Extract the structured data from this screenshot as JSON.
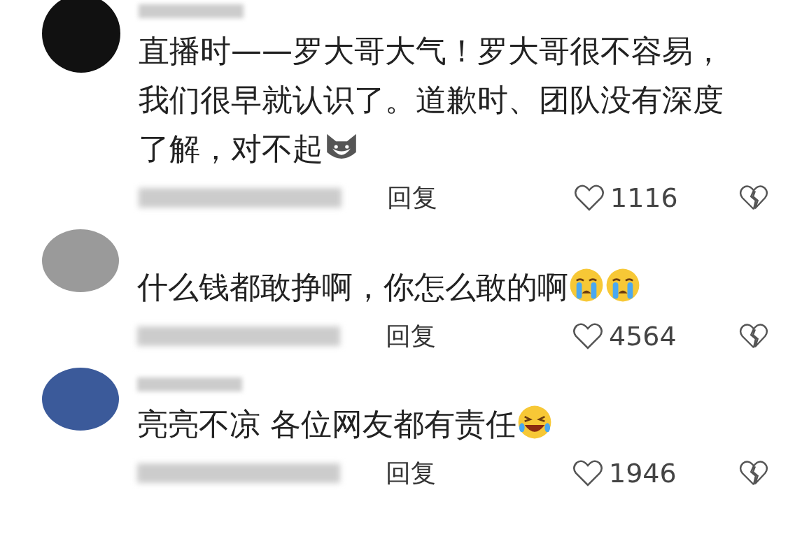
{
  "comments": [
    {
      "text": "直播时——罗大哥大气！罗大哥很不容易，我们很早就认识了。道歉时、团队没有深度了解，对不起",
      "emojis": [
        {
          "kind": "dog"
        }
      ],
      "reply": "回复",
      "likes": "1116",
      "avatar": {
        "kind": "hand"
      }
    },
    {
      "text": "什么钱都敢挣啊，你怎么敢的啊",
      "emojis": [
        {
          "kind": "cry"
        },
        {
          "kind": "cry"
        }
      ],
      "reply": "回复",
      "likes": "4564",
      "avatar": {
        "kind": "photo"
      }
    },
    {
      "text": "亮亮不凉 各位网友都有责任",
      "emojis": [
        {
          "kind": "laugh"
        }
      ],
      "reply": "回复",
      "likes": "1946",
      "avatar": {
        "kind": "painting"
      }
    }
  ]
}
